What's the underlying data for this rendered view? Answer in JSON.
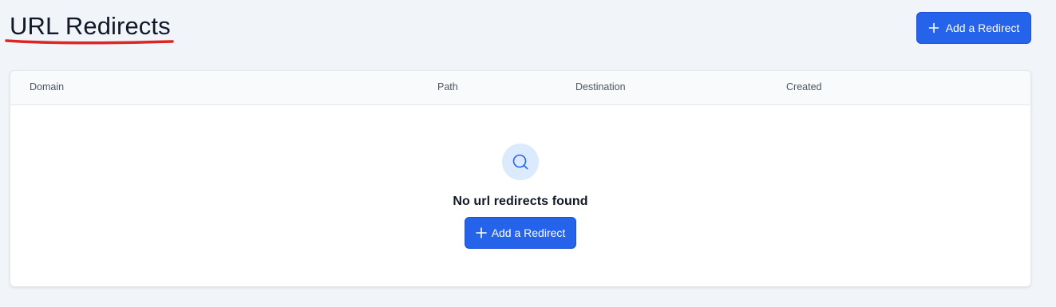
{
  "header": {
    "title": "URL Redirects",
    "add_button_label": "Add a Redirect"
  },
  "table": {
    "columns": [
      "Domain",
      "Path",
      "Destination",
      "Created"
    ],
    "rows": []
  },
  "empty_state": {
    "icon": "search-icon",
    "message": "No url redirects found",
    "button_label": "Add a Redirect"
  },
  "colors": {
    "primary": "#2563eb",
    "title_underline": "#dc2626",
    "page_background": "#f1f5f9"
  }
}
